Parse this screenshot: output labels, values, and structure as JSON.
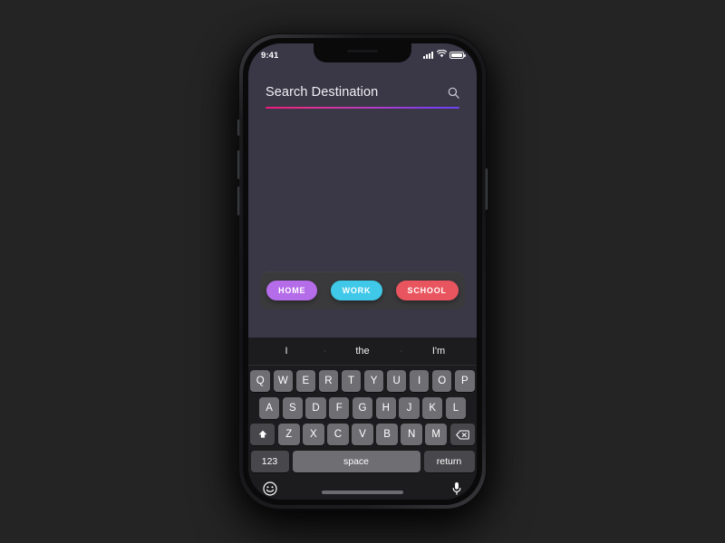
{
  "device": {
    "name": "smartphone-mockup"
  },
  "status_bar": {
    "time": "9:41",
    "signal_icon": "cellular-signal-icon",
    "wifi_icon": "wifi-icon",
    "battery_icon": "battery-full-icon"
  },
  "search": {
    "value": "Search Destination",
    "placeholder": "Search Destination",
    "icon": "search-icon",
    "underline_gradient_start": "#f0197f",
    "underline_gradient_end": "#6b44f2"
  },
  "shortcuts": {
    "chips": [
      {
        "label": "HOME",
        "color": "#b56ce8",
        "name": "chip-home"
      },
      {
        "label": "WORK",
        "color": "#3fc8e8",
        "name": "chip-work"
      },
      {
        "label": "SCHOOL",
        "color": "#e8555f",
        "name": "chip-school"
      }
    ]
  },
  "keyboard": {
    "predictions": [
      "I",
      "the",
      "I'm"
    ],
    "row1": [
      "Q",
      "W",
      "E",
      "R",
      "T",
      "Y",
      "U",
      "I",
      "O",
      "P"
    ],
    "row2": [
      "A",
      "S",
      "D",
      "F",
      "G",
      "H",
      "J",
      "K",
      "L"
    ],
    "row3": [
      "Z",
      "X",
      "C",
      "V",
      "B",
      "N",
      "M"
    ],
    "shift_icon": "shift-arrow-up-icon",
    "backspace_icon": "backspace-delete-icon",
    "numbers_key": "123",
    "space_key": "space",
    "return_key": "return",
    "emoji_icon": "emoji-smiley-icon",
    "mic_icon": "microphone-icon"
  },
  "theme": {
    "page_background": "#242424",
    "screen_background": "#3a3847",
    "keyboard_background": "#1c1c1e",
    "key_background": "#6e6e73",
    "key_dark_background": "#48484c",
    "chip_panel_background": "#3a3a3c"
  }
}
